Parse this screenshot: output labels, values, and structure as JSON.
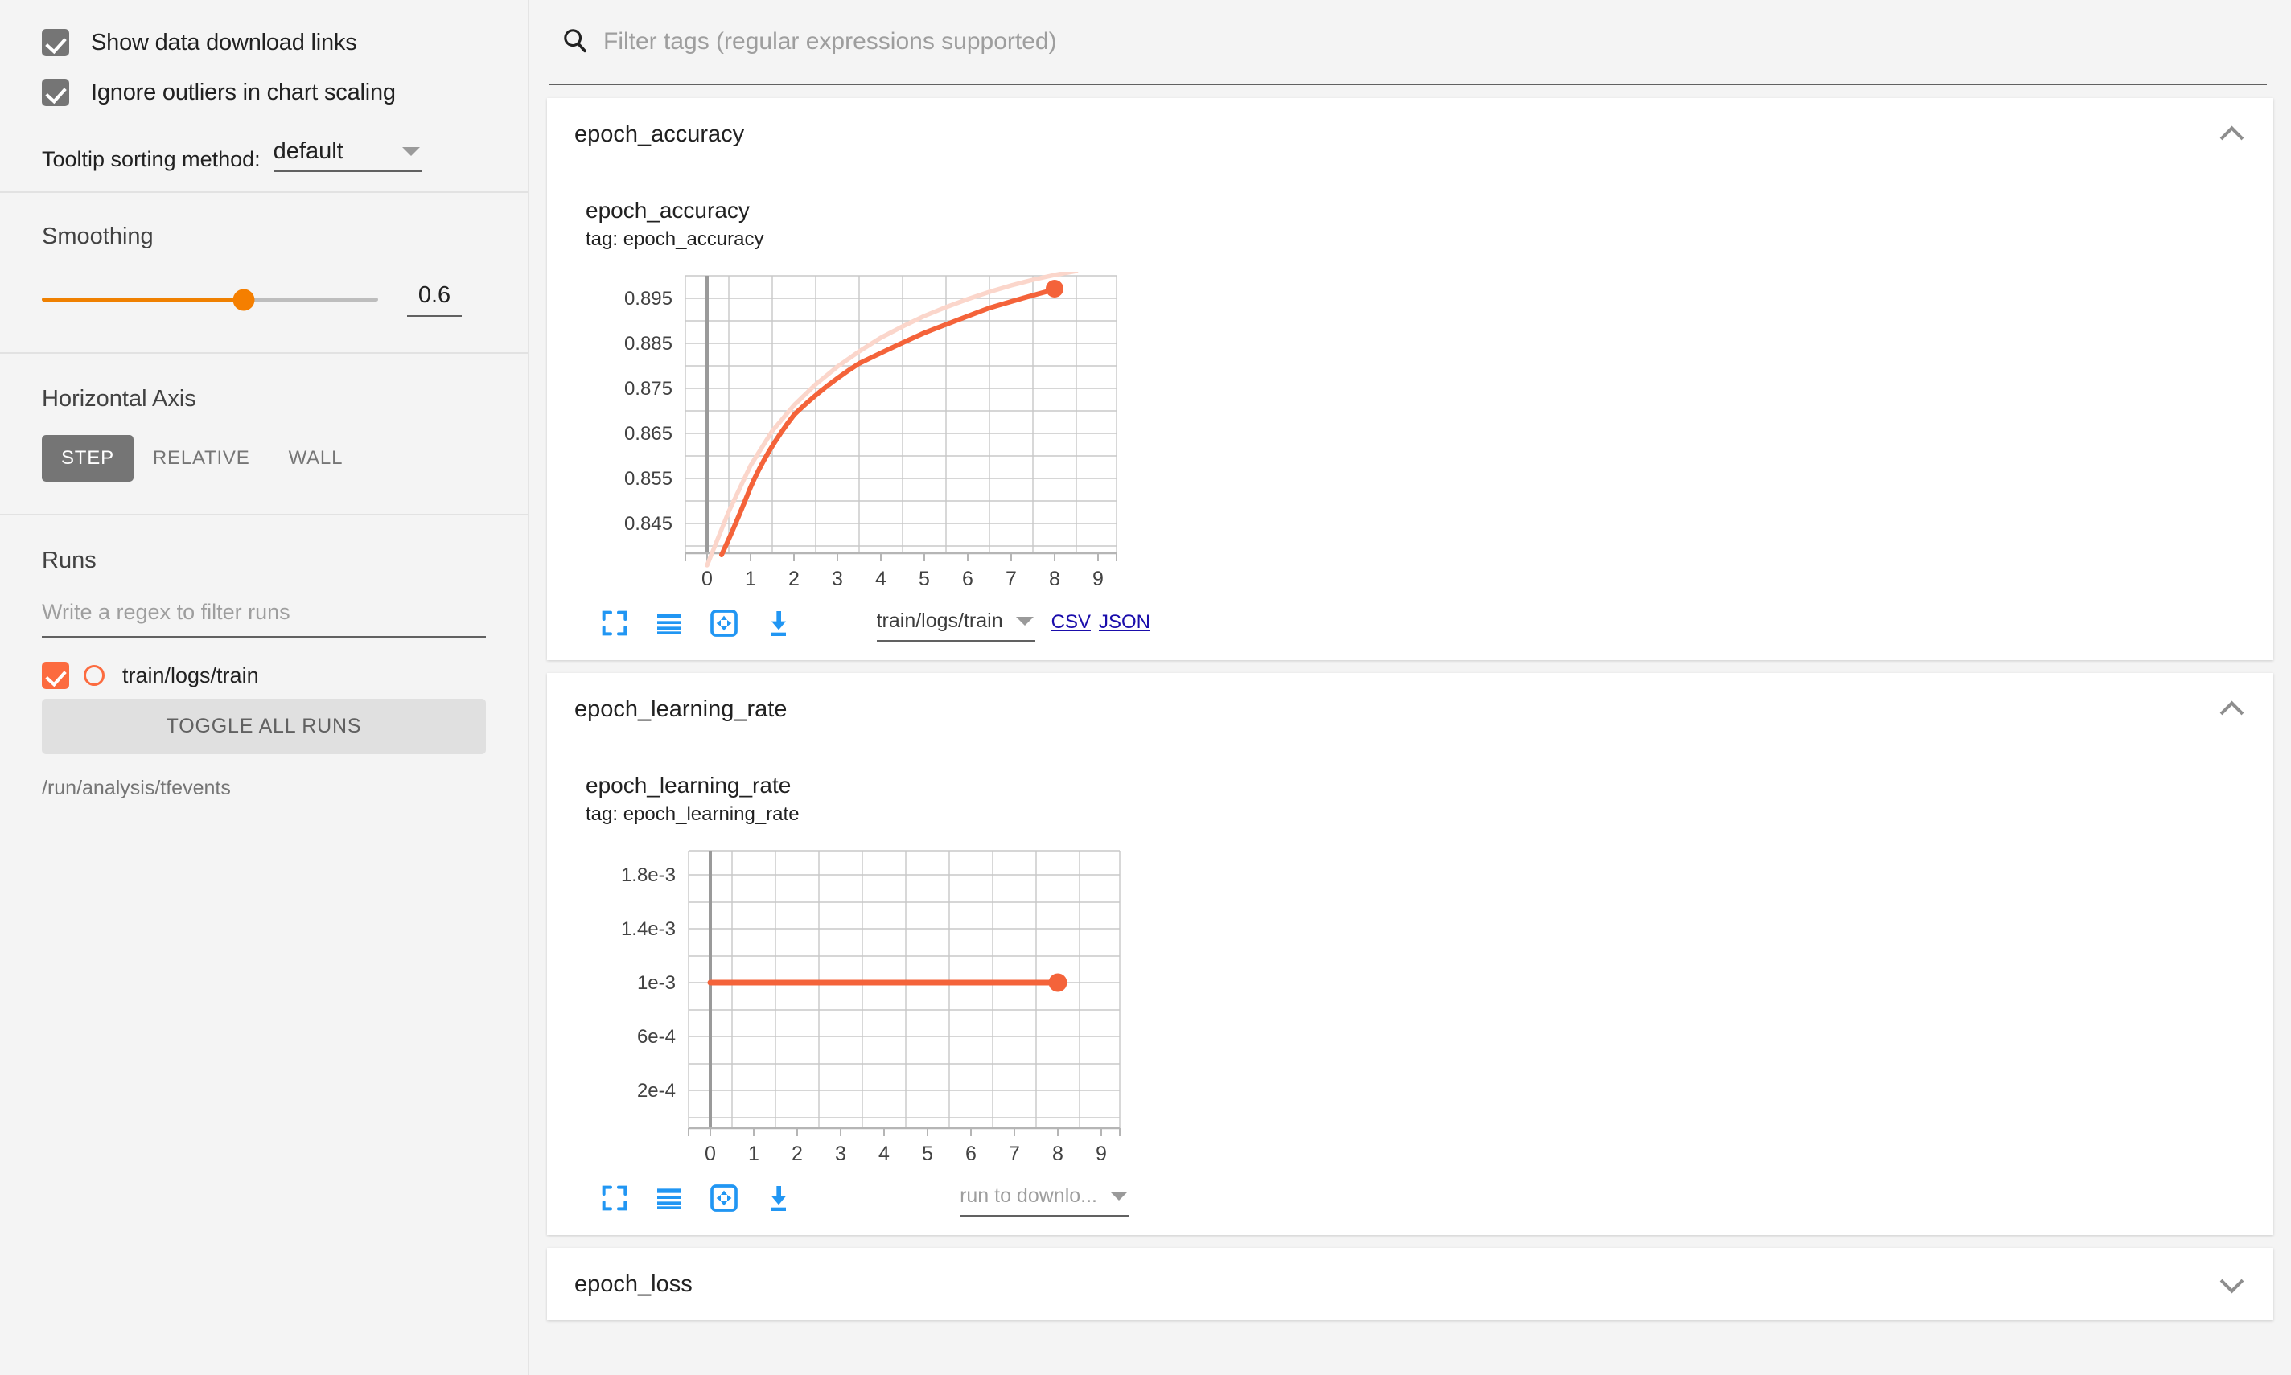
{
  "sidebar": {
    "checkboxes": [
      {
        "label": "Show data download links",
        "checked": true,
        "name": "show-download-links"
      },
      {
        "label": "Ignore outliers in chart scaling",
        "checked": true,
        "name": "ignore-outliers"
      }
    ],
    "tooltip": {
      "label": "Tooltip sorting method:",
      "value": "default"
    },
    "smoothing": {
      "title": "Smoothing",
      "value": "0.6",
      "fraction": 0.6
    },
    "horizontal_axis": {
      "title": "Horizontal Axis",
      "options": [
        "STEP",
        "RELATIVE",
        "WALL"
      ],
      "selected": "STEP"
    },
    "runs": {
      "title": "Runs",
      "filter_placeholder": "Write a regex to filter runs",
      "items": [
        {
          "label": "train/logs/train",
          "checked": true,
          "color": "#fc6b3f"
        }
      ],
      "toggle_all_label": "TOGGLE ALL RUNS",
      "logdir": "/run/analysis/tfevents"
    }
  },
  "search": {
    "placeholder": "Filter tags (regular expressions supported)"
  },
  "sections": [
    {
      "title": "epoch_accuracy",
      "expanded": true,
      "chevron": "chevron-up-icon"
    },
    {
      "title": "epoch_learning_rate",
      "expanded": true,
      "chevron": "chevron-up-icon"
    },
    {
      "title": "epoch_loss",
      "expanded": false,
      "chevron": "chevron-down-icon"
    }
  ],
  "charts": [
    {
      "title": "epoch_accuracy",
      "tag_label": "tag: epoch_accuracy",
      "download": {
        "run_value": "train/logs/train",
        "is_placeholder": false,
        "csv_label": "CSV",
        "json_label": "JSON"
      }
    },
    {
      "title": "epoch_learning_rate",
      "tag_label": "tag: epoch_learning_rate",
      "download": {
        "run_value": "run to downlo...",
        "is_placeholder": true,
        "csv_label": "",
        "json_label": ""
      }
    }
  ],
  "toolbar_icons": [
    "fullscreen-icon",
    "data-series-icon",
    "pan-icon",
    "download-icon"
  ],
  "colors": {
    "line": "#f4633a",
    "line_faded": "#fbd6cb",
    "accent_orange": "#fc6b3f",
    "slider_orange": "#f57f00",
    "link_blue": "#1a0dab",
    "icon_blue": "#2196f3"
  },
  "chart_data": [
    {
      "type": "line",
      "title": "epoch_accuracy",
      "subtitle": "tag: epoch_accuracy",
      "xlabel": "",
      "ylabel": "",
      "x": [
        0,
        1,
        2,
        3,
        4,
        5,
        6,
        7,
        8,
        9
      ],
      "xlim": [
        -0.6,
        9.6
      ],
      "ylim": [
        0.8405,
        0.9005
      ],
      "yticks": [
        0.845,
        0.855,
        0.865,
        0.875,
        0.885,
        0.895
      ],
      "ytick_labels": [
        "0.845",
        "0.855",
        "0.865",
        "0.875",
        "0.885",
        "0.895"
      ],
      "xticks": [
        0,
        1,
        2,
        3,
        4,
        5,
        6,
        7,
        8,
        9
      ],
      "xtick_labels": [
        "0",
        "1",
        "2",
        "3",
        "4",
        "5",
        "6",
        "7",
        "8",
        "9"
      ],
      "grid": true,
      "legend": "none",
      "series": [
        {
          "name": "train/logs/train (smoothed)",
          "color": "#f4633a",
          "width": 5,
          "marker_last": true,
          "values": [
            0.8395,
            0.8435,
            0.8592,
            0.8708,
            0.8786,
            0.8841,
            0.8879,
            0.8908,
            0.893,
            0.8986
          ]
        },
        {
          "name": "train/logs/train (raw)",
          "color": "#fbd6cb",
          "width": 5,
          "marker_last": false,
          "values": [
            0.8385,
            0.8597,
            0.8749,
            0.8828,
            0.8878,
            0.8916,
            0.8946,
            0.8971,
            0.8993,
            0.9011
          ]
        }
      ]
    },
    {
      "type": "line",
      "title": "epoch_learning_rate",
      "subtitle": "tag: epoch_learning_rate",
      "xlabel": "",
      "ylabel": "",
      "x": [
        0,
        1,
        2,
        3,
        4,
        5,
        6,
        7,
        8,
        9
      ],
      "xlim": [
        -0.8,
        9.8
      ],
      "ylim": [
        2e-05,
        0.00199
      ],
      "yticks": [
        0.0002,
        0.0006,
        0.001,
        0.0014,
        0.0018
      ],
      "ytick_labels": [
        "2e-4",
        "6e-4",
        "1e-3",
        "1.4e-3",
        "1.8e-3"
      ],
      "xticks": [
        0,
        1,
        2,
        3,
        4,
        5,
        6,
        7,
        8,
        9
      ],
      "xtick_labels": [
        "0",
        "1",
        "2",
        "3",
        "4",
        "5",
        "6",
        "7",
        "8",
        "9"
      ],
      "grid": true,
      "legend": "none",
      "series": [
        {
          "name": "train/logs/train",
          "color": "#f4633a",
          "width": 6,
          "marker_last": true,
          "values": [
            0.001,
            0.001,
            0.001,
            0.001,
            0.001,
            0.001,
            0.001,
            0.001,
            0.001,
            0.001
          ]
        }
      ]
    }
  ]
}
